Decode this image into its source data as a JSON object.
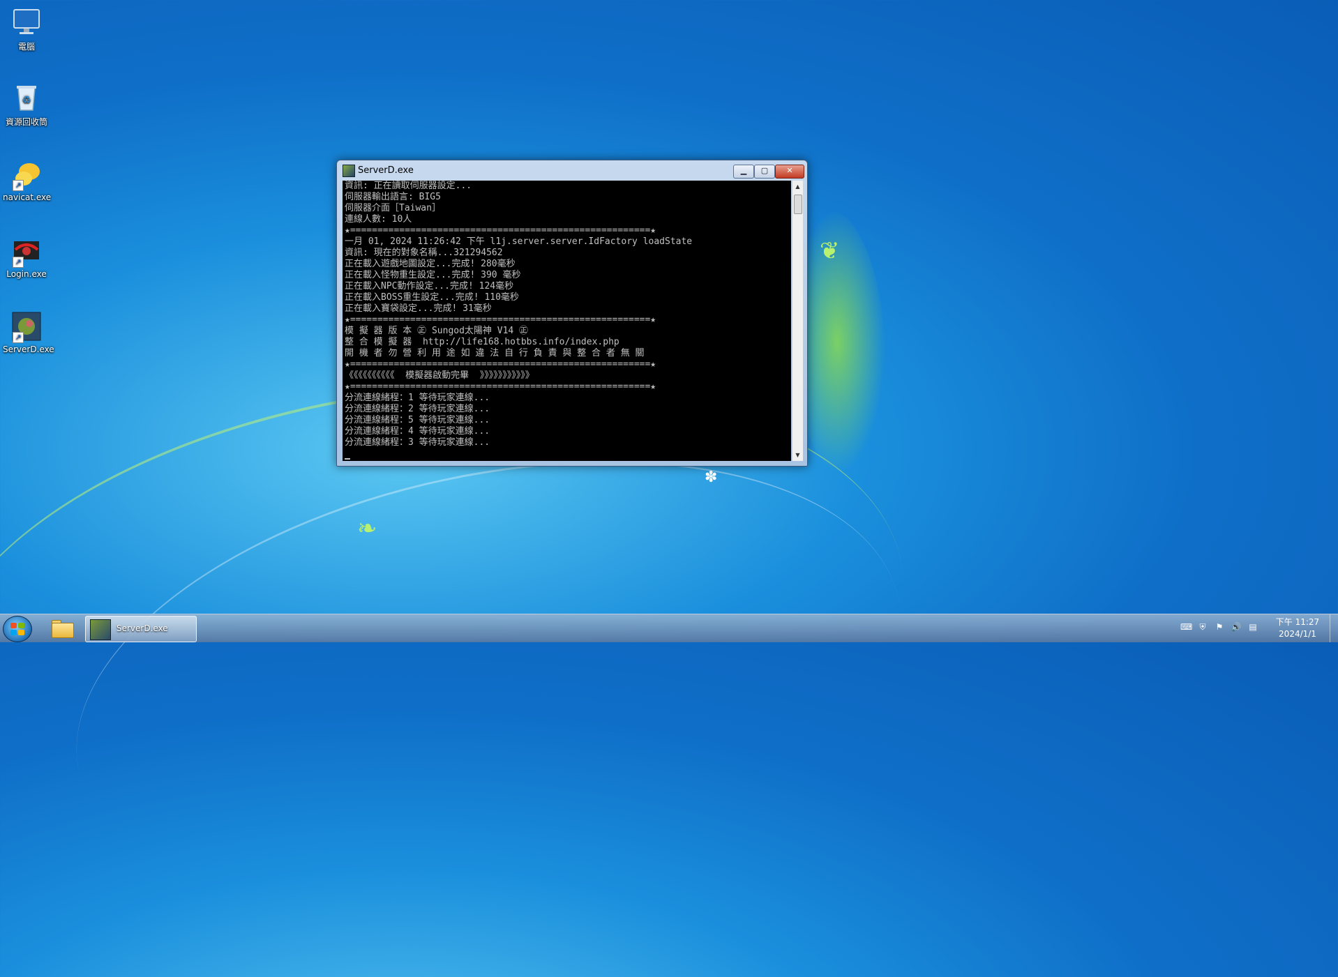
{
  "desktop": {
    "icons": [
      {
        "label": "電腦",
        "icon": "computer-icon"
      },
      {
        "label": "資源回收筒",
        "icon": "recycle-bin-icon"
      },
      {
        "label": "navicat.exe",
        "icon": "navicat-icon"
      },
      {
        "label": "Login.exe",
        "icon": "login-app-icon"
      },
      {
        "label": "ServerD.exe",
        "icon": "serverd-app-icon"
      }
    ]
  },
  "window": {
    "title": "ServerD.exe",
    "lines": [
      "資訊: 正在讀取伺服器設定...",
      "伺服器輸出語言: BIG5",
      "伺服器介面［Taiwan］",
      "連線人數: 10人",
      "★=======================================================★",
      "一月 01, 2024 11:26:42 下午 l1j.server.server.IdFactory loadState",
      "資訊: 現在的對象名稱...321294562",
      "正在載入遊戲地圖設定...完成! 280毫秒",
      "正在載入怪物重生設定...完成! 390 毫秒",
      "正在載入NPC動作設定...完成! 124毫秒",
      "正在載入BOSS重生設定...完成! 110毫秒",
      "正在載入寶袋設定...完成! 31毫秒",
      "★=======================================================★",
      "模 擬 器 版 本 ㊣ Sungod太陽神 V14 ㊣",
      "整 合 模 擬 器  http://life168.hotbbs.info/index.php",
      "開 機 者 勿 營 利 用 途 如 違 法 自 行 負 責 與 整 合 者 無 關",
      "★=======================================================★",
      "《《《《《《《《《《  模擬器啟動完畢  》》》》》》》》》》》",
      "★=======================================================★",
      "分流連線緒程：1 等待玩家連線...",
      "分流連線緒程：2 等待玩家連線...",
      "分流連線緒程：5 等待玩家連線...",
      "分流連線緒程：4 等待玩家連線...",
      "分流連線緒程：3 等待玩家連線..."
    ]
  },
  "taskbar": {
    "app_label": "ServerD.exe",
    "clock_time": "下午 11:27",
    "clock_date": "2024/1/1"
  }
}
